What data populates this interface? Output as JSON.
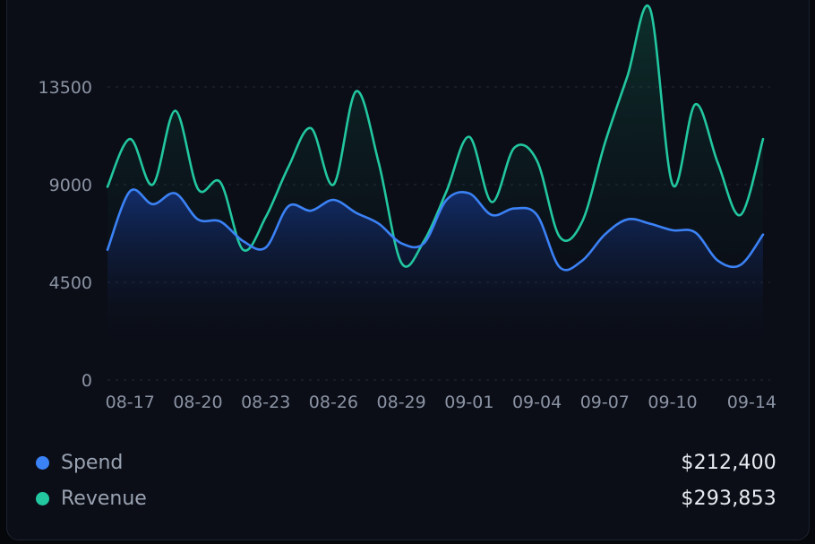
{
  "colors": {
    "spend": "#3b82f6",
    "revenue": "#22c7a0",
    "grid": "#232a38",
    "axis_text": "#8b93a3",
    "card_bg": "#0b0e17"
  },
  "legend": [
    {
      "name": "Spend",
      "total": "$212,400",
      "color": "#3b82f6"
    },
    {
      "name": "Revenue",
      "total": "$293,853",
      "color": "#22c7a0"
    }
  ],
  "chart_data": {
    "type": "area",
    "x_ticks": [
      "08-17",
      "08-20",
      "08-23",
      "08-26",
      "08-29",
      "09-01",
      "09-04",
      "09-07",
      "09-10",
      "09-14"
    ],
    "y_ticks": [
      0,
      4500,
      9000,
      13500
    ],
    "ylim": [
      0,
      13500
    ],
    "grid": true,
    "legend_position": "bottom",
    "x": [
      "08-16",
      "08-17",
      "08-18",
      "08-19",
      "08-20",
      "08-21",
      "08-22",
      "08-23",
      "08-24",
      "08-25",
      "08-26",
      "08-27",
      "08-28",
      "08-29",
      "08-30",
      "08-31",
      "09-01",
      "09-02",
      "09-03",
      "09-04",
      "09-05",
      "09-06",
      "09-07",
      "09-08",
      "09-09",
      "09-10",
      "09-11",
      "09-12",
      "09-13",
      "09-14"
    ],
    "series": [
      {
        "name": "Revenue",
        "values": [
          8900,
          11100,
          9000,
          12400,
          8800,
          9100,
          6000,
          7500,
          9800,
          11600,
          9000,
          13300,
          10000,
          5400,
          6400,
          8700,
          11200,
          8200,
          10700,
          10100,
          6600,
          7300,
          10900,
          14000,
          17100,
          9000,
          12700,
          10000,
          7600,
          11100
        ]
      },
      {
        "name": "Spend",
        "values": [
          6000,
          8700,
          8100,
          8600,
          7400,
          7300,
          6400,
          6100,
          8000,
          7800,
          8300,
          7700,
          7200,
          6300,
          6300,
          8300,
          8600,
          7600,
          7900,
          7600,
          5200,
          5500,
          6700,
          7400,
          7200,
          6900,
          6800,
          5500,
          5300,
          6700
        ]
      }
    ]
  }
}
